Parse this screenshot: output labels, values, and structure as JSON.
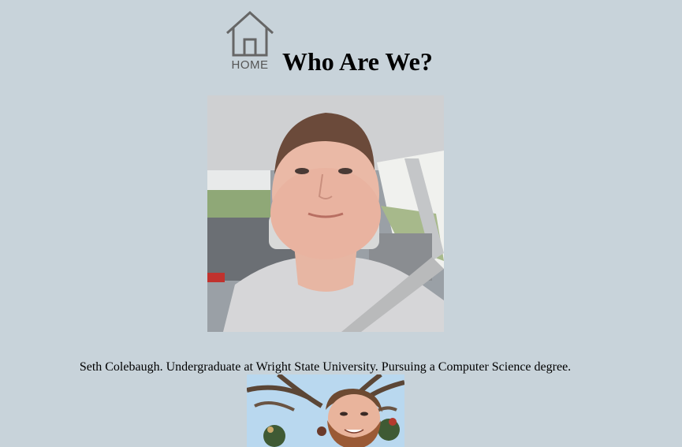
{
  "nav": {
    "home_label": "HOME"
  },
  "header": {
    "title": "Who Are We?"
  },
  "members": [
    {
      "caption": "Seth Colebaugh. Undergraduate at Wright State University. Pursuing a Computer Science degree."
    }
  ],
  "colors": {
    "background": "#c8d3da",
    "home_icon": "#666666"
  }
}
